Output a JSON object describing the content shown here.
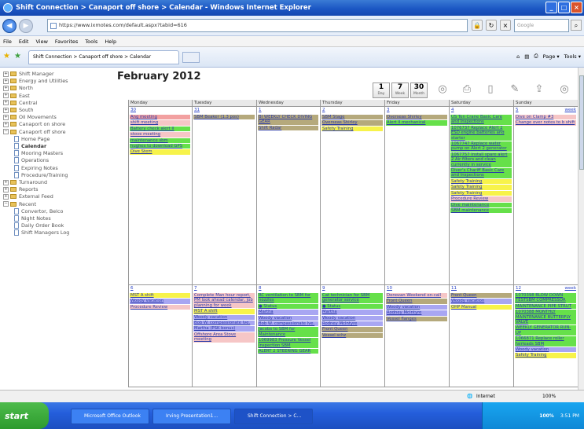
{
  "window": {
    "title": "Shift Connection > Canaport off shore > Calendar - Windows Internet Explorer",
    "btn_min": "_",
    "btn_max": "□",
    "btn_close": "×"
  },
  "address": {
    "url": "https://www.ixmotes.com/default.aspx?tabid=616",
    "search_placeholder": "Google",
    "refresh": "↻",
    "stop": "×",
    "go": "→",
    "search_btn": "⌕"
  },
  "nav": {
    "back": "◀",
    "forward": "▶"
  },
  "menu": [
    "File",
    "Edit",
    "View",
    "Favorites",
    "Tools",
    "Help"
  ],
  "tab": {
    "label": "Shift Connection > Canaport off shore > Calendar"
  },
  "toolbar": {
    "page_label": "Page ▾",
    "tools_label": "Tools ▾",
    "home": "⌂",
    "feeds": "▤",
    "print": "⎙"
  },
  "sidebar": {
    "items": [
      {
        "label": "Shift Manager",
        "level": 0,
        "exp": "+",
        "icon": "folder"
      },
      {
        "label": "Energy and Utilities",
        "level": 0,
        "exp": "+",
        "icon": "folder"
      },
      {
        "label": "North",
        "level": 0,
        "exp": "+",
        "icon": "folder"
      },
      {
        "label": "East",
        "level": 0,
        "exp": "+",
        "icon": "folder"
      },
      {
        "label": "Central",
        "level": 0,
        "exp": "+",
        "icon": "folder"
      },
      {
        "label": "South",
        "level": 0,
        "exp": "+",
        "icon": "folder"
      },
      {
        "label": "Oil Movements",
        "level": 0,
        "exp": "+",
        "icon": "folder"
      },
      {
        "label": "Canaport on shore",
        "level": 0,
        "exp": "+",
        "icon": "folder"
      },
      {
        "label": "Canaport off shore",
        "level": 0,
        "exp": "−",
        "icon": "folder"
      },
      {
        "label": "Home Page",
        "level": 1,
        "icon": "page"
      },
      {
        "label": "Calendar",
        "level": 1,
        "icon": "page",
        "bold": true
      },
      {
        "label": "Mooring Masters",
        "level": 1,
        "icon": "page"
      },
      {
        "label": "Operations",
        "level": 1,
        "icon": "page"
      },
      {
        "label": "Expiring Notes",
        "level": 1,
        "icon": "page"
      },
      {
        "label": "Procedure/Training",
        "level": 1,
        "icon": "page"
      },
      {
        "label": "Turnaround",
        "level": 0,
        "exp": "+",
        "icon": "folder"
      },
      {
        "label": "Reports",
        "level": 0,
        "exp": "+",
        "icon": "folder"
      },
      {
        "label": "External Feed",
        "level": 0,
        "exp": "+",
        "icon": "folder"
      },
      {
        "label": "Recent",
        "level": 0,
        "exp": "−",
        "icon": "folder"
      },
      {
        "label": "Convertor, Belco",
        "level": 1,
        "icon": "page"
      },
      {
        "label": "Night Notes",
        "level": 1,
        "icon": "page"
      },
      {
        "label": "Daily Order Book",
        "level": 1,
        "icon": "page"
      },
      {
        "label": "Shift Managers Log",
        "level": 1,
        "icon": "page"
      }
    ]
  },
  "calendar": {
    "title": "February 2012",
    "views": [
      {
        "num": "1",
        "label": "Day"
      },
      {
        "num": "7",
        "label": "Week"
      },
      {
        "num": "30",
        "label": "Month"
      }
    ],
    "icons": [
      "refresh-icon",
      "print-icon",
      "blank-page-icon",
      "edit-icon",
      "export-icon",
      "forward-icon"
    ],
    "days": [
      "Monday",
      "Tuesday",
      "Wednesday",
      "Thursday",
      "Friday",
      "Saturday",
      "Sunday"
    ],
    "week_label": "week",
    "colors": {
      "red": "#f2a0a0",
      "green": "#66e04a",
      "yellow": "#f7f34a",
      "pink": "#f6c6c6",
      "tan": "#b5a97c",
      "purple": "#a8a6f2",
      "white": "#ffffff"
    },
    "weeks": [
      {
        "cells": [
          {
            "day": "30",
            "events": [
              {
                "t": "Ang meeting",
                "c": "red"
              },
              {
                "t": "shift meeting",
                "c": "pink"
              },
              {
                "t": "Battery check alert II",
                "c": "green"
              },
              {
                "t": "stove meeting",
                "c": "pink"
              },
              {
                "t": "maintenance sbm",
                "c": "green"
              },
              {
                "t": "hughes to download GPS",
                "c": "green"
              },
              {
                "t": "Dive Stem",
                "c": "yellow"
              }
            ]
          },
          {
            "day": "31",
            "events": [
              {
                "t": "SBM Beaker (1.3 pos)",
                "c": "tan"
              }
            ]
          },
          {
            "day": "1",
            "events": [
              {
                "t": "BI WEEKLY CHECK DIVING GEAR",
                "c": "tan",
                "wrap": true
              },
              {
                "t": "Shift Radar",
                "c": "tan"
              }
            ]
          },
          {
            "day": "2",
            "events": [
              {
                "t": "SBM Stage",
                "c": "tan"
              },
              {
                "t": "Overseas Shirley",
                "c": "tan"
              },
              {
                "t": "Safety Training",
                "c": "yellow"
              }
            ]
          },
          {
            "day": "3",
            "events": [
              {
                "t": "Overseas Shirley",
                "c": "tan"
              },
              {
                "t": "Alert II mechanical",
                "c": "green"
              }
            ]
          },
          {
            "day": "4",
            "events": [
              {
                "t": "US Ten Crane Basic Care and Inspections",
                "c": "green",
                "wrap": true
              },
              {
                "t": "1076737 Replace Alert 2 ESD engine batteries and starter",
                "c": "green",
                "wrap": true
              },
              {
                "t": "1067747 Replace water pump on Alert 2 generator",
                "c": "green",
                "wrap": true
              },
              {
                "t": "1067757 Install spare alert 2 Air filters and clean currently in service",
                "c": "green",
                "wrap": true
              },
              {
                "t": "Diver's Chariff Basic Care and Inspections",
                "c": "green",
                "wrap": true
              },
              {
                "t": "Safety Training",
                "c": "yellow"
              },
              {
                "t": "Safety Training",
                "c": "yellow"
              },
              {
                "t": "Safety Training",
                "c": "yellow"
              },
              {
                "t": "Procedure Review",
                "c": "pink"
              },
              {
                "t": "Dive maintenance",
                "c": "green"
              },
              {
                "t": "SBM maintenance",
                "c": "green"
              }
            ]
          },
          {
            "day": "5",
            "week": true,
            "events": [
              {
                "t": "Dive on Clamp #3",
                "c": "pink"
              },
              {
                "t": "Change over notes to b shift",
                "c": "pink",
                "wrap": true
              }
            ]
          }
        ]
      },
      {
        "cells": [
          {
            "day": "6",
            "events": [
              {
                "t": "MST A shift",
                "c": "yellow"
              },
              {
                "t": "Woody vacation",
                "c": "purple"
              },
              {
                "t": "Procedure Review",
                "c": "pink"
              }
            ]
          },
          {
            "day": "7",
            "events": [
              {
                "t": "Complete Man hour report, PM look ahead calendar, job planning for week",
                "c": "pink",
                "wrap": true
              },
              {
                "t": "MST A shift",
                "c": "yellow"
              },
              {
                "t": "Woody vacation",
                "c": "purple"
              },
              {
                "t": "Bob W. compassionate lve.",
                "c": "purple",
                "wrap": true
              },
              {
                "t": "Martha (PSK bonus)",
                "c": "purple"
              },
              {
                "t": "Offshore Area Stove meeting",
                "c": "pink",
                "wrap": true
              }
            ]
          },
          {
            "day": "8",
            "events": [
              {
                "t": "RC ventilation to SBM for nozzles",
                "c": "green",
                "wrap": true
              },
              {
                "t": "● Status",
                "c": "green"
              },
              {
                "t": "Martha",
                "c": "purple"
              },
              {
                "t": "Woody vacation",
                "c": "purple"
              },
              {
                "t": "Bob W. compassionate lve.",
                "c": "purple",
                "wrap": true
              },
              {
                "t": "Jacobs to SBM for Maintenance",
                "c": "green",
                "wrap": true
              },
              {
                "t": "1069983 Pressure Vessel Inspection SBM",
                "c": "green",
                "wrap": true
              },
              {
                "t": "ALERT 2 STEERING GEAR",
                "c": "green"
              }
            ]
          },
          {
            "day": "9",
            "events": [
              {
                "t": "Cat technician for SBM generator service",
                "c": "green",
                "wrap": true
              },
              {
                "t": "● Status",
                "c": "green"
              },
              {
                "t": "Martha",
                "c": "purple"
              },
              {
                "t": "Woody vacation",
                "c": "purple"
              },
              {
                "t": "Rodney McIntyre",
                "c": "purple"
              },
              {
                "t": "Front Queen",
                "c": "tan"
              },
              {
                "t": "Vessel schz",
                "c": "tan"
              }
            ]
          },
          {
            "day": "10",
            "events": [
              {
                "t": "Donovan Weekend on-call",
                "c": "pink",
                "wrap": true
              },
              {
                "t": "Front Queen",
                "c": "tan"
              },
              {
                "t": "Woody vacation",
                "c": "purple"
              },
              {
                "t": "Rodney McIntyre",
                "c": "purple"
              },
              {
                "t": "Vessel flanges",
                "c": "tan"
              }
            ]
          },
          {
            "day": "11",
            "events": [
              {
                "t": "Front Queen",
                "c": "tan"
              },
              {
                "t": "Woody vacation",
                "c": "purple"
              },
              {
                "t": "OHP Manual",
                "c": "yellow"
              }
            ]
          },
          {
            "day": "12",
            "week": true,
            "events": [
              {
                "t": "1070398 BLOW DOWN TESTSBM COMPRESSOR",
                "c": "green",
                "wrap": true
              },
              {
                "t": "MAINTENANCE PIPE STRUT",
                "c": "green",
                "wrap": true
              },
              {
                "t": "1070388 MONTHLY MAINTENANCE BUTTERFLY VALVE",
                "c": "green",
                "wrap": true
              },
              {
                "t": "WEEKLY GENERATOR RUN-UP",
                "c": "green",
                "wrap": true
              },
              {
                "t": "1066871 Replace roller fairleads SBM",
                "c": "green",
                "wrap": true
              },
              {
                "t": "Woody vacation",
                "c": "purple"
              },
              {
                "t": "Safety Training",
                "c": "yellow"
              }
            ]
          }
        ]
      }
    ]
  },
  "status": {
    "zone": "Internet",
    "zoom": "100%"
  },
  "taskbar": {
    "start": "start",
    "items": [
      "Microsoft Office Outlook",
      "Irving Presentation1...",
      "Shift Connection > C..."
    ],
    "clock": "3:51 PM",
    "tray_pct": "100%"
  }
}
